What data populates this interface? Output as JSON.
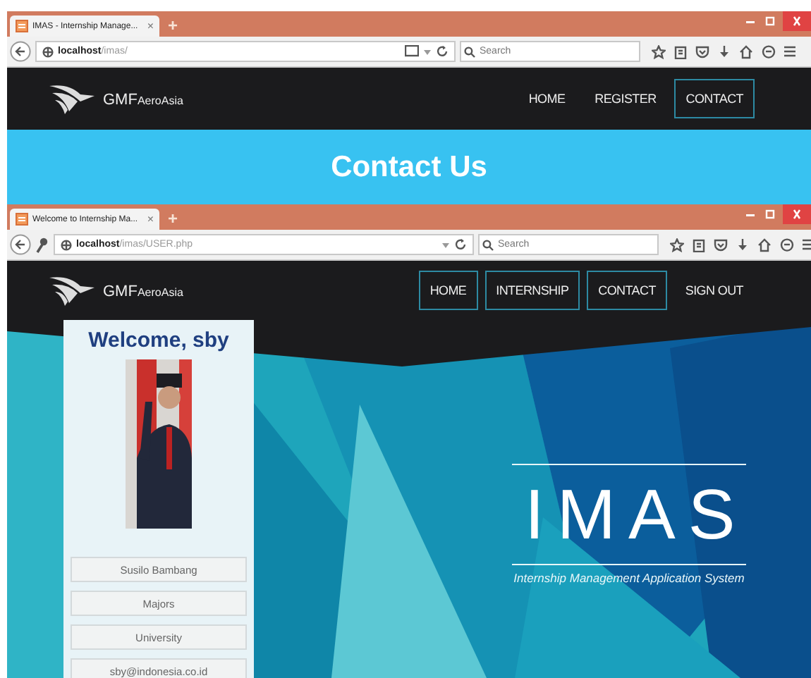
{
  "windows": [
    {
      "tab": {
        "title": "IMAS - Internship Manage...",
        "close": "×",
        "new_tab": "+"
      },
      "address": {
        "host": "localhost",
        "path": "/imas/",
        "key_icon": false,
        "reader_icon": true
      },
      "search": {
        "placeholder": "Search"
      },
      "nav": {
        "brand": "GMF",
        "brand_suffix": "AeroAsia",
        "items": [
          {
            "label": "HOME",
            "outlined": false
          },
          {
            "label": "REGISTER",
            "outlined": false
          },
          {
            "label": "CONTACT",
            "outlined": true
          }
        ]
      },
      "content": {
        "kind": "banner",
        "title": "Contact Us"
      }
    },
    {
      "tab": {
        "title": "Welcome to Internship Ma...",
        "close": "×",
        "new_tab": "+"
      },
      "address": {
        "host": "localhost",
        "path": "/imas/USER.php",
        "key_icon": true,
        "reader_icon": false
      },
      "search": {
        "placeholder": "Search"
      },
      "nav": {
        "brand": "GMF",
        "brand_suffix": "AeroAsia",
        "items": [
          {
            "label": "HOME",
            "outlined": true
          },
          {
            "label": "INTERNSHIP",
            "outlined": true
          },
          {
            "label": "CONTACT",
            "outlined": true
          },
          {
            "label": "SIGN OUT",
            "outlined": false
          }
        ]
      },
      "content": {
        "kind": "dashboard",
        "welcome": "Welcome, sby",
        "profile_fields": [
          {
            "value": "Susilo Bambang"
          },
          {
            "value": "Majors"
          },
          {
            "value": "University"
          },
          {
            "value": "sby@indonesia.co.id"
          }
        ],
        "hero": {
          "title": "IMAS",
          "subtitle": "Internship Management Application System"
        }
      }
    }
  ]
}
